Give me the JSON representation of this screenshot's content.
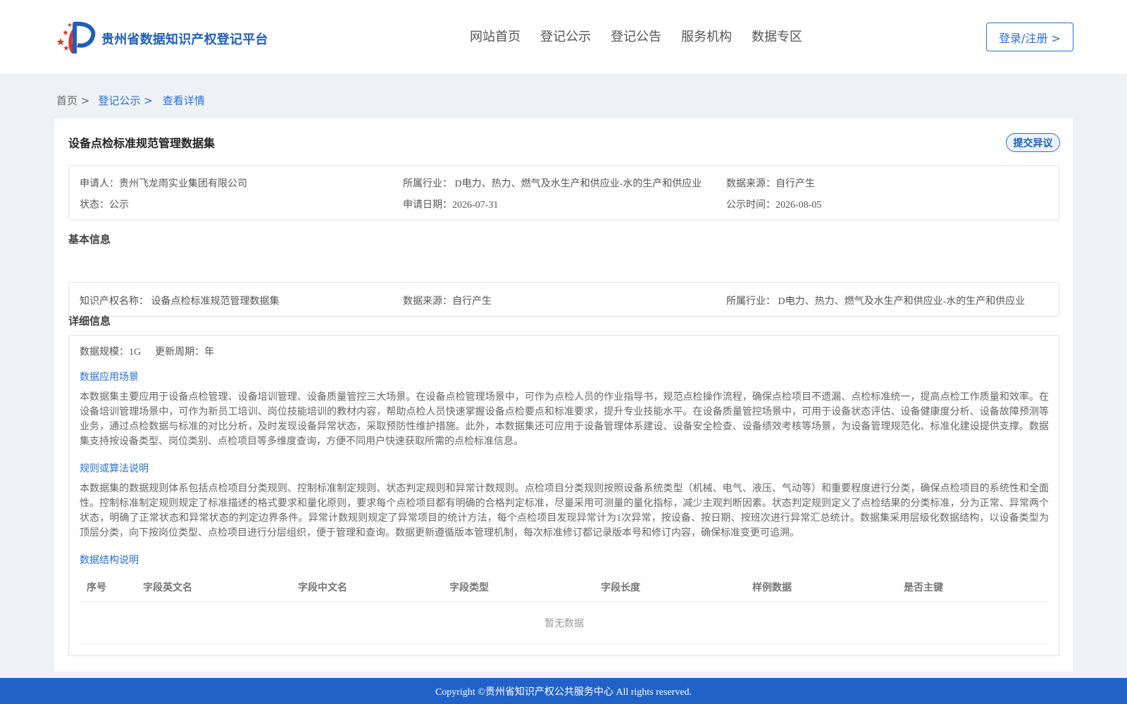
{
  "header": {
    "site_name": "贵州省数据知识产权登记平台",
    "nav": [
      "网站首页",
      "登记公示",
      "登记公告",
      "服务机构",
      "数据专区"
    ],
    "login_label": "登录/注册 >"
  },
  "breadcrumb": {
    "home": "首页 >",
    "section": "登记公示 >",
    "current": "查看详情"
  },
  "dataset": {
    "title": "设备点检标准规范管理数据集",
    "objection_label": "提交异议",
    "summary": {
      "applicant": "申请人：贵州飞龙雨实业集团有限公司",
      "industry": "所属行业： D电力、热力、燃气及水生产和供应业-水的生产和供应业",
      "source": "数据来源：自行产生",
      "status": "状态：公示",
      "apply_date": "申请日期：2026-07-31",
      "publish_date": "公示时间：2026-08-05"
    }
  },
  "basic": {
    "title": "基本信息",
    "ip_name": "知识产权名称： 设备点检标准规范管理数据集",
    "source": "数据来源：自行产生",
    "industry": "所属行业： D电力、热力、燃气及水生产和供应业-水的生产和供应业"
  },
  "detail": {
    "title": "详细信息",
    "scale": "数据规模：1G",
    "cycle": "更新周期：年",
    "scenario_title": "数据应用场景",
    "scenario_text": "本数据集主要应用于设备点检管理、设备培训管理、设备质量管控三大场景。在设备点检管理场景中，可作为点检人员的作业指导书，规范点检操作流程，确保点检项目不遗漏、点检标准统一，提高点检工作质量和效率。在设备培训管理场景中，可作为新员工培训、岗位技能培训的教材内容，帮助点检人员快速掌握设备点检要点和标准要求，提升专业技能水平。在设备质量管控场景中，可用于设备状态评估、设备健康度分析、设备故障预测等业务，通过点检数据与标准的对比分析，及时发现设备异常状态，采取预防性维护措施。此外，本数据集还可应用于设备管理体系建设、设备安全检查、设备绩效考核等场景，为设备管理规范化、标准化建设提供支撑。数据集支持按设备类型、岗位类别、点检项目等多维度查询，方便不同用户快速获取所需的点检标准信息。",
    "rules_title": "规则或算法说明",
    "rules_text": "本数据集的数据规则体系包括点检项目分类规则、控制标准制定规则、状态判定规则和异常计数规则。点检项目分类规则按照设备系统类型（机械、电气、液压、气动等）和重要程度进行分类，确保点检项目的系统性和全面性。控制标准制定规则规定了标准描述的格式要求和量化原则，要求每个点检项目都有明确的合格判定标准，尽量采用可测量的量化指标，减少主观判断因素。状态判定规则定义了点检结果的分类标准，分为正常、异常两个状态，明确了正常状态和异常状态的判定边界条件。异常计数规则规定了异常项目的统计方法，每个点检项目发现异常计为1次异常，按设备、按日期、按班次进行异常汇总统计。数据集采用层级化数据结构，以设备类型为顶层分类，向下按岗位类型、点检项目进行分层组织，便于管理和查询。数据更新遵循版本管理机制，每次标准修订都记录版本号和修订内容，确保标准变更可追溯。",
    "structure_title": "数据结构说明",
    "table": {
      "columns": [
        "序号",
        "字段英文名",
        "字段中文名",
        "字段类型",
        "字段长度",
        "样例数据",
        "是否主键"
      ],
      "empty_text": "暂无数据"
    }
  },
  "footer": {
    "copyright": "Copyright ©贵州省知识产权公共服务中心 All rights reserved."
  }
}
